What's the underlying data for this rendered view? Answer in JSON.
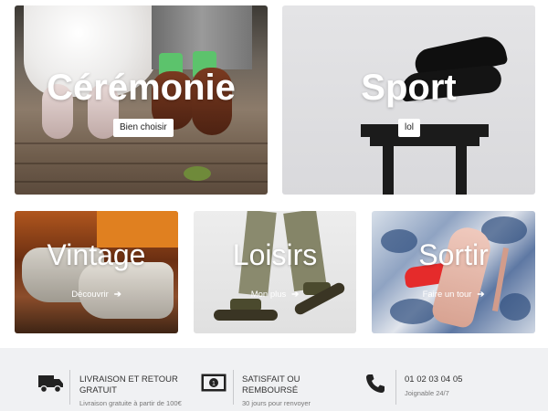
{
  "tiles": {
    "ceremonie": {
      "title": "Cérémonie",
      "button": "Bien choisir"
    },
    "sport": {
      "title": "Sport",
      "button": "lol"
    },
    "vintage": {
      "title": "Vintage",
      "link": "Découvrir"
    },
    "loisirs": {
      "title": "Loisirs",
      "link": "Mon plus"
    },
    "sortir": {
      "title": "Sortir",
      "link": "Faire un tour"
    }
  },
  "footer": {
    "delivery": {
      "icon": "truck-icon",
      "title": "LIVRAISON ET RETOUR GRATUIT",
      "subtitle": "Livraison gratuite à partir de 100€"
    },
    "satisfaction": {
      "icon": "money-icon",
      "title": "SATISFAIT OU REMBOURSÉ",
      "subtitle": "30 jours pour renvoyer"
    },
    "contact": {
      "icon": "phone-icon",
      "title": "01 02 03 04 05",
      "subtitle": "Joignable 24/7"
    }
  },
  "colors": {
    "footer_bg": "#f0f1f3",
    "text_dark": "#333333",
    "text_muted": "#777777"
  }
}
